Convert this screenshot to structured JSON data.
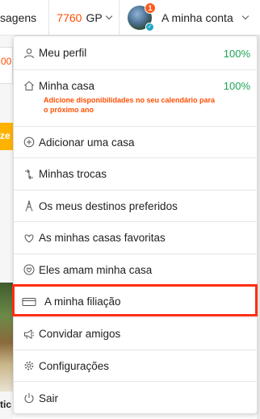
{
  "topbar": {
    "messages_partial": "sagens",
    "gp_value": "7760",
    "gp_unit": "GP",
    "notification_count": "1",
    "account_label": "A minha conta"
  },
  "background": {
    "card_partial": "00",
    "cta_partial": "ze s",
    "caption_partial": "tic"
  },
  "menu": {
    "profile": {
      "label": "Meu perfil",
      "percent": "100%"
    },
    "home": {
      "label": "Minha casa",
      "percent": "100%",
      "note": "Adicione disponibilidades no seu calendário para o próximo ano"
    },
    "add_home": {
      "label": "Adicionar uma casa"
    },
    "exchanges": {
      "label": "Minhas trocas"
    },
    "destinations": {
      "label": "Os meus destinos preferidos"
    },
    "favorites": {
      "label": "As minhas casas favoritas"
    },
    "loved": {
      "label": "Eles amam minha casa"
    },
    "membership": {
      "label": "A minha filiação"
    },
    "invite": {
      "label": "Convidar amigos"
    },
    "settings": {
      "label": "Configurações"
    },
    "logout": {
      "label": "Sair"
    }
  },
  "colors": {
    "accent": "#ff4e00",
    "complete": "#1fa356",
    "highlight": "#ff2d10"
  },
  "icons": {
    "profile": "user-icon",
    "home": "house-icon",
    "add_home": "plus-circle-icon",
    "exchanges": "exchange-icon",
    "destinations": "eiffel-tower-icon",
    "favorites": "heart-icon",
    "loved": "heart-bubble-icon",
    "membership": "card-icon",
    "invite": "megaphone-icon",
    "settings": "gear-icon",
    "logout": "power-icon"
  }
}
